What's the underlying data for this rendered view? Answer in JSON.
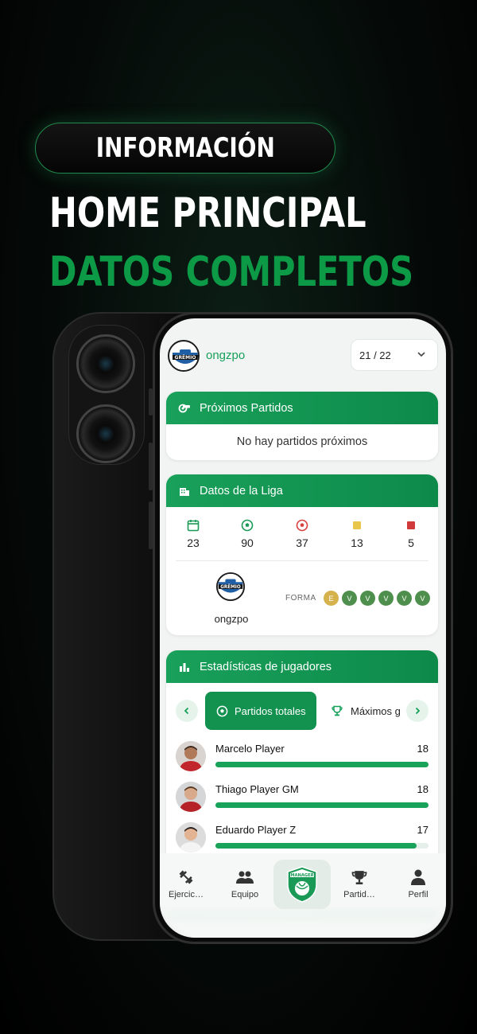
{
  "promo": {
    "badge": "INFORMACIÓN",
    "headline_1": "HOME PRINCIPAL",
    "headline_2": "DATOS COMPLETOS"
  },
  "app": {
    "team_name": "ongzpo",
    "season": "21 / 22",
    "next_matches": {
      "title": "Próximos Partidos",
      "empty": "No hay partidos próximos"
    },
    "league": {
      "title": "Datos de la Liga",
      "stats": [
        {
          "icon": "calendar-icon",
          "value": "23",
          "color": "#1b9a55"
        },
        {
          "icon": "soccer-ball-icon",
          "value": "90",
          "color": "#1b9a55"
        },
        {
          "icon": "soccer-ball-conceded-icon",
          "value": "37",
          "color": "#d84040"
        },
        {
          "icon": "yellow-card-icon",
          "value": "13",
          "color": "#e8c64a"
        },
        {
          "icon": "red-card-icon",
          "value": "5",
          "color": "#d03a3a"
        }
      ],
      "team_label": "ongzpo",
      "form_label": "FORMA",
      "form": [
        {
          "result": "E",
          "color": "#d6b24c"
        },
        {
          "result": "V",
          "color": "#4f8f4d"
        },
        {
          "result": "V",
          "color": "#4f8f4d"
        },
        {
          "result": "V",
          "color": "#4f8f4d"
        },
        {
          "result": "V",
          "color": "#4f8f4d"
        },
        {
          "result": "V",
          "color": "#4f8f4d"
        }
      ]
    },
    "player_stats": {
      "title": "Estadísticas de jugadores",
      "tab_active": "Partidos totales",
      "tab_next": "Máximos g",
      "players": [
        {
          "name": "Marcelo Player",
          "value": "18",
          "progress": 1.0
        },
        {
          "name": "Thiago Player GM",
          "value": "18",
          "progress": 1.0
        },
        {
          "name": "Eduardo Player Z",
          "value": "17",
          "progress": 0.944
        }
      ]
    },
    "nav": {
      "items": [
        {
          "label": "Ejercic…",
          "icon": "dumbbell-icon"
        },
        {
          "label": "Equipo",
          "icon": "team-icon"
        },
        {
          "label": "Partid…",
          "icon": "trophy-icon"
        },
        {
          "label": "Perfil",
          "icon": "person-icon"
        }
      ],
      "center_logo_text": "MANAGER"
    },
    "logo_text": "GRÊMIO"
  }
}
